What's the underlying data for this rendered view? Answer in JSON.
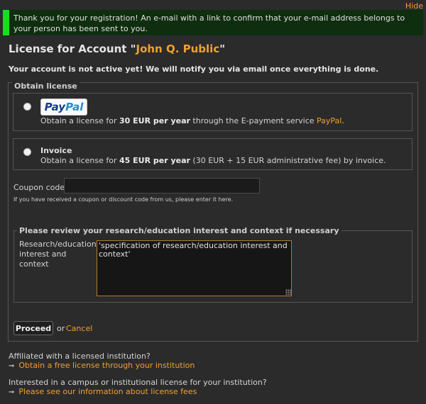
{
  "hide_label": "Hide",
  "notice": {
    "text": "Thank you for your registration! An e-mail with a link to confirm that your e-mail address belongs to your person has been sent to you."
  },
  "page": {
    "title_prefix": "License for Account \"",
    "account_name": "John Q. Public",
    "title_suffix": "\"",
    "inactive_warning": "Your account is not active yet! We will notify you via email once everything is done."
  },
  "obtain": {
    "legend": "Obtain license",
    "options": [
      {
        "logo_part1": "Pay",
        "logo_part2": "Pal",
        "desc_pre": "Obtain a license for ",
        "desc_bold": "30 EUR per year",
        "desc_mid": " through the E-payment service ",
        "desc_link": "PayPal",
        "desc_end": "."
      },
      {
        "title": "Invoice",
        "desc_pre": "Obtain a license for ",
        "desc_bold": "45 EUR per year",
        "desc_end": " (30 EUR + 15 EUR administrative fee) by invoice."
      }
    ]
  },
  "coupon": {
    "label": "Coupon code:",
    "value": "",
    "hint": "If you have received a coupon or discount code from us, please enter it here."
  },
  "review": {
    "legend": "Please review your research/education interest and context if necessary",
    "label": "Research/education interest and context",
    "value": "'specification of research/education interest and context'"
  },
  "actions": {
    "proceed": "Proceed",
    "or": "or",
    "cancel": "Cancel"
  },
  "footer": {
    "affiliated_q": "Affiliated with a licensed institution?",
    "affiliated_link": "Obtain a free license through your institution",
    "campus_q": "Interested in a campus or institutional license for your institution?",
    "campus_link": "Please see our information about license fees",
    "arrow": "➞"
  },
  "colors": {
    "accent": "#f0a030",
    "notice_bar": "#16e016",
    "notice_bg": "#0f2d0f",
    "background": "#2b2b2b"
  }
}
